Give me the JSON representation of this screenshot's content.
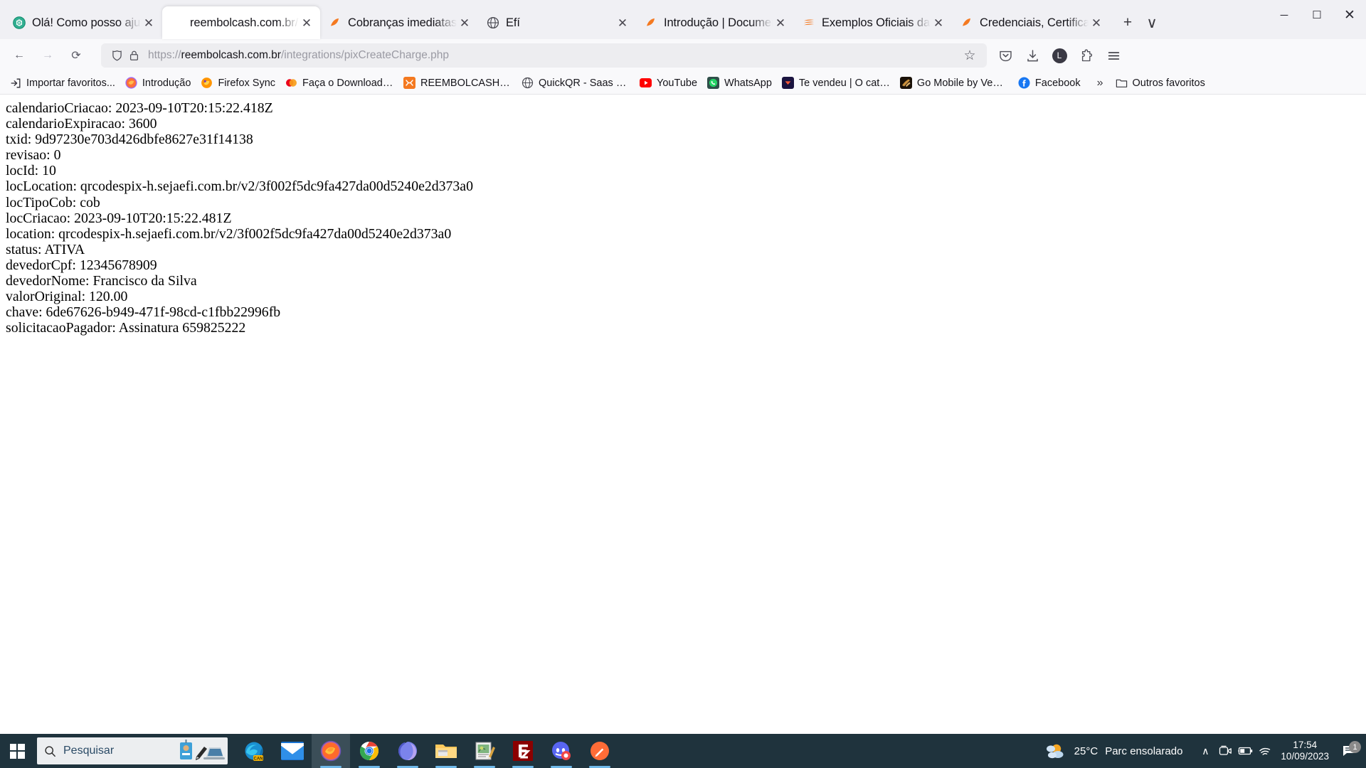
{
  "window": {
    "minimize_label": "─",
    "maximize_label": "☐",
    "close_label": "✕"
  },
  "tabs": [
    {
      "label": "Olá! Como posso ajudar",
      "icon": "chatgpt-icon",
      "active": false,
      "close": "✕"
    },
    {
      "label": "reembolcash.com.br/int",
      "icon": "blank-icon",
      "active": true,
      "close": "✕"
    },
    {
      "label": "Cobranças imediatas | D",
      "icon": "efi-orange-icon",
      "active": false,
      "close": "✕"
    },
    {
      "label": "Efí",
      "icon": "globe-icon",
      "active": false,
      "close": "✕"
    },
    {
      "label": "Introdução | Documenta",
      "icon": "efi-orange-icon",
      "active": false,
      "close": "✕"
    },
    {
      "label": "Exemplos Oficiais da AP",
      "icon": "efi-stripes-icon",
      "active": false,
      "close": "✕"
    },
    {
      "label": "Credenciais, Certificado",
      "icon": "efi-orange-icon",
      "active": false,
      "close": "✕"
    }
  ],
  "tabstrip": {
    "new_tab_label": "+",
    "list_all_tabs_label": "∨"
  },
  "toolbar": {
    "back_label": "←",
    "forward_label": "→",
    "reload_label": "⟳",
    "url_prefix": "https://",
    "url_host": "reembolcash.com.br",
    "url_path": "/integrations/pixCreateCharge.php",
    "bookmark_star": "☆",
    "pocket_icon": "pocket-icon",
    "downloads_icon": "download-icon",
    "account_letter": "L",
    "extensions_icon": "puzzle-icon",
    "menu_icon": "hamburger-menu-icon"
  },
  "bookmarks": {
    "items": [
      {
        "label": "Importar favoritos...",
        "icon": "import-icon"
      },
      {
        "label": "Introdução",
        "icon": "firefox-icon"
      },
      {
        "label": "Firefox Sync",
        "icon": "firefox-sync-icon"
      },
      {
        "label": "Faça o Download dos ...",
        "icon": "mastercard-icon"
      },
      {
        "label": "REEMBOLCASH - Um ...",
        "icon": "reembolcash-icon"
      },
      {
        "label": "QuickQR - Saas - Cont...",
        "icon": "globe-icon"
      },
      {
        "label": "YouTube",
        "icon": "youtube-icon"
      },
      {
        "label": "WhatsApp",
        "icon": "whatsapp-icon"
      },
      {
        "label": "Te vendeu | O catálog...",
        "icon": "tevendeu-icon"
      },
      {
        "label": "Go Mobile by VegaTh...",
        "icon": "gomobile-icon"
      },
      {
        "label": "Facebook",
        "icon": "facebook-icon"
      }
    ],
    "overflow_label": "»",
    "other_bookmarks": {
      "label": "Outros favoritos",
      "icon": "folder-icon"
    }
  },
  "page": {
    "lines": [
      "calendarioCriacao: 2023-09-10T20:15:22.418Z",
      "calendarioExpiracao: 3600",
      "txid: 9d97230e703d426dbfe8627e31f14138",
      "revisao: 0",
      "locId: 10",
      "locLocation: qrcodespix-h.sejaefi.com.br/v2/3f002f5dc9fa427da00d5240e2d373a0",
      "locTipoCob: cob",
      "locCriacao: 2023-09-10T20:15:22.481Z",
      "location: qrcodespix-h.sejaefi.com.br/v2/3f002f5dc9fa427da00d5240e2d373a0",
      "status: ATIVA",
      "devedorCpf: 12345678909",
      "devedorNome: Francisco da Silva",
      "valorOriginal: 120.00",
      "chave: 6de67626-b949-471f-98cd-c1fbb22996fb",
      "solicitacaoPagador: Assinatura 659825222"
    ]
  },
  "taskbar": {
    "start_icon": "windows-start-icon",
    "search_placeholder": "Pesquisar",
    "search_icon": "search-icon",
    "apps": [
      {
        "name": "edge-canary-icon",
        "running": false,
        "active": false
      },
      {
        "name": "mail-icon",
        "running": false,
        "active": false
      },
      {
        "name": "firefox-icon",
        "running": true,
        "active": true
      },
      {
        "name": "chrome-icon",
        "running": true,
        "active": false
      },
      {
        "name": "microsoft-365-icon",
        "running": true,
        "active": false
      },
      {
        "name": "file-explorer-icon",
        "running": true,
        "active": false
      },
      {
        "name": "notepad-icon",
        "running": true,
        "active": false
      },
      {
        "name": "filezilla-icon",
        "running": true,
        "active": false
      },
      {
        "name": "discord-icon",
        "running": true,
        "active": false
      },
      {
        "name": "postman-icon",
        "running": true,
        "active": false
      }
    ],
    "tray": {
      "weather_temp": "25°C",
      "weather_desc": "Parc ensolarado",
      "weather_icon": "partly-sunny-icon",
      "show_hidden_label": "∧",
      "meet_icon": "camera-icon",
      "battery_icon": "battery-charging-icon",
      "network_icon": "wifi-icon",
      "time": "17:54",
      "date": "10/09/2023",
      "notification_icon": "notification-icon",
      "notification_count": "1"
    }
  },
  "colors": {
    "accent_orange": "#f47920",
    "taskbar_bg": "#1f333d",
    "chrome_bg": "#f9f9fb",
    "tabstrip_bg": "#f0f0f4"
  }
}
